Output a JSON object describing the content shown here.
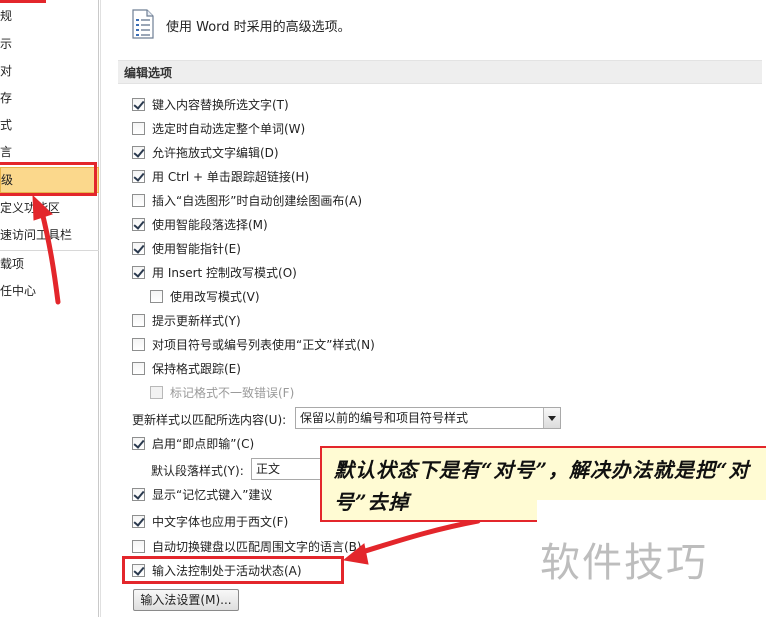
{
  "nav": {
    "items": [
      {
        "label": "规",
        "selected": false
      },
      {
        "label": "示",
        "selected": false
      },
      {
        "label": "对",
        "selected": false
      },
      {
        "label": "存",
        "selected": false
      },
      {
        "label": "式",
        "selected": false
      },
      {
        "label": "言",
        "selected": false
      },
      {
        "label": "级",
        "selected": true
      },
      {
        "label": "定义功能区",
        "selected": false
      },
      {
        "label": "速访问工具栏",
        "selected": false
      },
      {
        "label": "载项",
        "selected": false
      },
      {
        "label": "任中心",
        "selected": false
      }
    ]
  },
  "header": {
    "text": "使用 Word 时采用的高级选项。"
  },
  "section": {
    "title": "编辑选项"
  },
  "options": [
    {
      "label": "键入内容替换所选文字(T)",
      "checked": true,
      "disabled": false
    },
    {
      "label": "选定时自动选定整个单词(W)",
      "checked": false,
      "disabled": false
    },
    {
      "label": "允许拖放式文字编辑(D)",
      "checked": true,
      "disabled": false
    },
    {
      "label": "用 Ctrl + 单击跟踪超链接(H)",
      "checked": true,
      "disabled": false
    },
    {
      "label": "插入“自选图形”时自动创建绘图画布(A)",
      "checked": false,
      "disabled": false
    },
    {
      "label": "使用智能段落选择(M)",
      "checked": true,
      "disabled": false
    },
    {
      "label": "使用智能指针(E)",
      "checked": true,
      "disabled": false
    },
    {
      "label": "用 Insert 控制改写模式(O)",
      "checked": true,
      "disabled": false
    },
    {
      "label": "使用改写模式(V)",
      "checked": false,
      "disabled": false
    },
    {
      "label": "提示更新样式(Y)",
      "checked": false,
      "disabled": false
    },
    {
      "label": "对项目符号或编号列表使用“正文”样式(N)",
      "checked": false,
      "disabled": false
    },
    {
      "label": "保持格式跟踪(E)",
      "checked": false,
      "disabled": false
    },
    {
      "label": "标记格式不一致错误(F)",
      "checked": false,
      "disabled": true
    }
  ],
  "update_style": {
    "label": "更新样式以匹配所选内容(U):",
    "value": "保留以前的编号和项目符号样式"
  },
  "click_type": {
    "label": "启用“即点即输”(C)",
    "checked": true
  },
  "default_para": {
    "label": "默认段落样式(Y):",
    "value": "正文"
  },
  "options2": [
    {
      "label": "显示“记忆式键入”建议",
      "checked": true
    },
    {
      "label": "中文字体也应用于西文(F)",
      "checked": true
    },
    {
      "label": "自动切换键盘以匹配周围文字的语言(B)",
      "checked": false
    },
    {
      "label": "输入法控制处于活动状态(A)",
      "checked": true
    }
  ],
  "ime_button": {
    "label": "输入法设置(M)..."
  },
  "callout": {
    "text": "默认状态下是有“对号”，解决办法就是把“对号”去掉"
  },
  "watermark": {
    "text": "软件技巧"
  },
  "colors": {
    "annotation_red": "#e3262b",
    "callout_bg": "#fffbd3",
    "nav_selected": "#fbd88c"
  }
}
